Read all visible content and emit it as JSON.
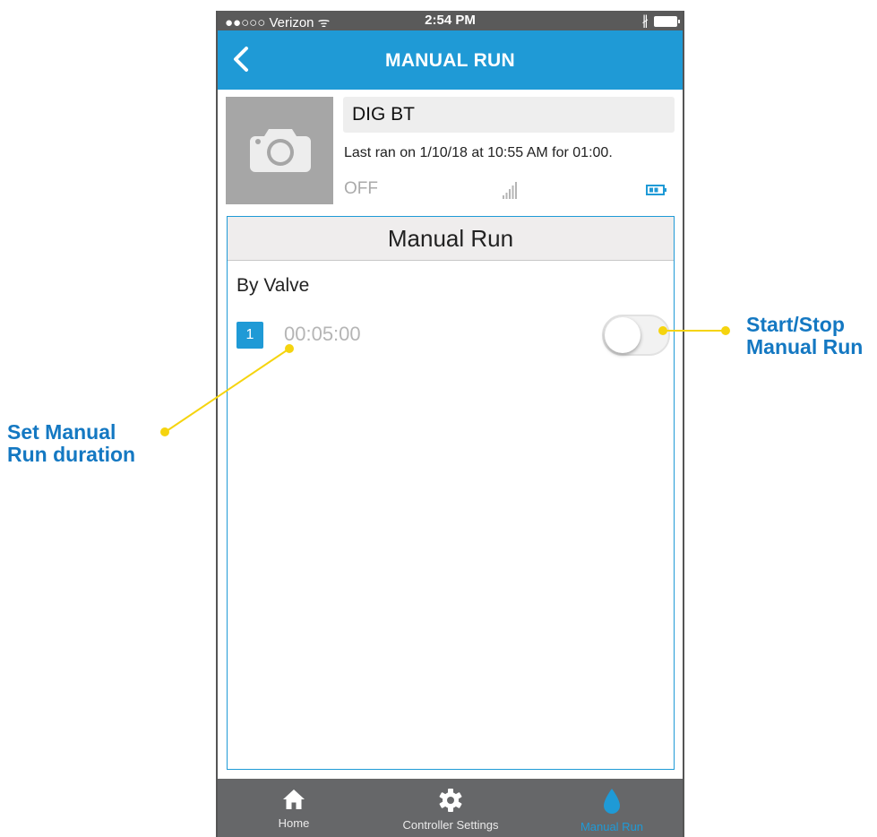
{
  "status_bar": {
    "carrier": "●●○○○ Verizon ᯤ",
    "time": "2:54 PM",
    "bluetooth": "∦"
  },
  "nav": {
    "title": "MANUAL RUN",
    "back_icon": "chevron-left-icon"
  },
  "controller": {
    "name": "DIG BT",
    "last_ran": "Last ran on 1/10/18 at 10:55 AM for 01:00.",
    "state": "OFF",
    "photo_icon": "camera-icon",
    "signal_icon": "signal-strength-icon",
    "battery_icon": "battery-icon"
  },
  "manual_run": {
    "header": "Manual Run",
    "section_label": "By Valve",
    "valves": [
      {
        "number": "1",
        "duration": "00:05:00",
        "running": false
      }
    ]
  },
  "tabs": [
    {
      "label": "Home",
      "icon": "home-icon",
      "active": false
    },
    {
      "label": "Controller Settings",
      "icon": "gear-icon",
      "active": false
    },
    {
      "label": "Manual Run",
      "icon": "water-drop-icon",
      "active": true
    }
  ],
  "annotations": {
    "toggle_callout": "Start/Stop Manual Run",
    "duration_callout": "Set Manual Run duration",
    "callout_color": "#1478c2",
    "leader_color": "#f5d40f"
  },
  "colors": {
    "accent": "#1f9ad6",
    "tabbar": "#666769",
    "statusbar": "#5a5a5a"
  }
}
